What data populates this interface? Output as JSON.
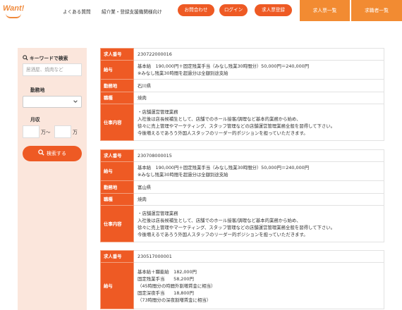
{
  "header": {
    "logo": "Want!",
    "nav": [
      "よくある質問",
      "紹介業・登録支援機関様向け"
    ],
    "buttons": [
      "お問合わせ",
      "ログイン",
      "求人票登録"
    ],
    "tabs": [
      "求人票一覧",
      "求職者一覧"
    ],
    "colors": {
      "accent": "#ee5a24",
      "tab": "#f28b32"
    }
  },
  "sidebar": {
    "keyword_title": "キーワードで検索",
    "keyword_placeholder": "居酒屋、焼肉など",
    "location_label": "勤務地",
    "location_value": "",
    "salary_label": "月収",
    "salary_sep": "万〜",
    "salary_unit": "万",
    "search_label": "検索する"
  },
  "jobs": [
    {
      "id_label": "求人番号",
      "id": "230722000016",
      "salary_label": "給与",
      "salary": "基本給　190,000円＋固定残業手当（みなし残業30時間分）50,000円＝240,000円\n※みなし残業30時間を超過分は全額別途支給",
      "location_label": "勤務地",
      "location": "石川県",
      "type_label": "職種",
      "type": "焼肉",
      "desc_label": "仕事内容",
      "desc": "・店舗運営管理業務\n入社後は店長候補生として、店舗でのホール接客/調理など基本的業務から始め、\n徐々に売上管理やマーケティング、スタッフ管理などの店舗運営管理業務全般を習得して下さい。\n今後増えるであろう外国人スタッフのリーダー的ポジションを担っていただきます。"
    },
    {
      "id_label": "求人番号",
      "id": "230708000015",
      "salary_label": "給与",
      "salary": "基本給　190,000円＋固定残業手当（みなし残業30時間分）50,000円＝240,000円\n※みなし残業30時間を超過分は全額別途支給",
      "location_label": "勤務地",
      "location": "富山県",
      "type_label": "職種",
      "type": "焼肉",
      "desc_label": "仕事内容",
      "desc": "・店舗運営管理業務\n入社後は店長候補生として、店舗でのホール接客/調理など基本的業務から始め、\n徐々に売上管理やマーケティング、スタッフ管理などの店舗運営管理業務全般を習得して下さい。\n今後増えるであろう外国人スタッフのリーダー的ポジションを担っていただきます。"
    },
    {
      "id_label": "求人番号",
      "id": "230517000001",
      "salary_label": "給与",
      "salary": "基本給＋職能給　182,000円\n固定残業手当　　58,200円\n（45時間分の時間外割増賃金に相当）\n固定深夜手当　　18,800円\n（73時間分の深夜割増賃金に相当）"
    }
  ]
}
